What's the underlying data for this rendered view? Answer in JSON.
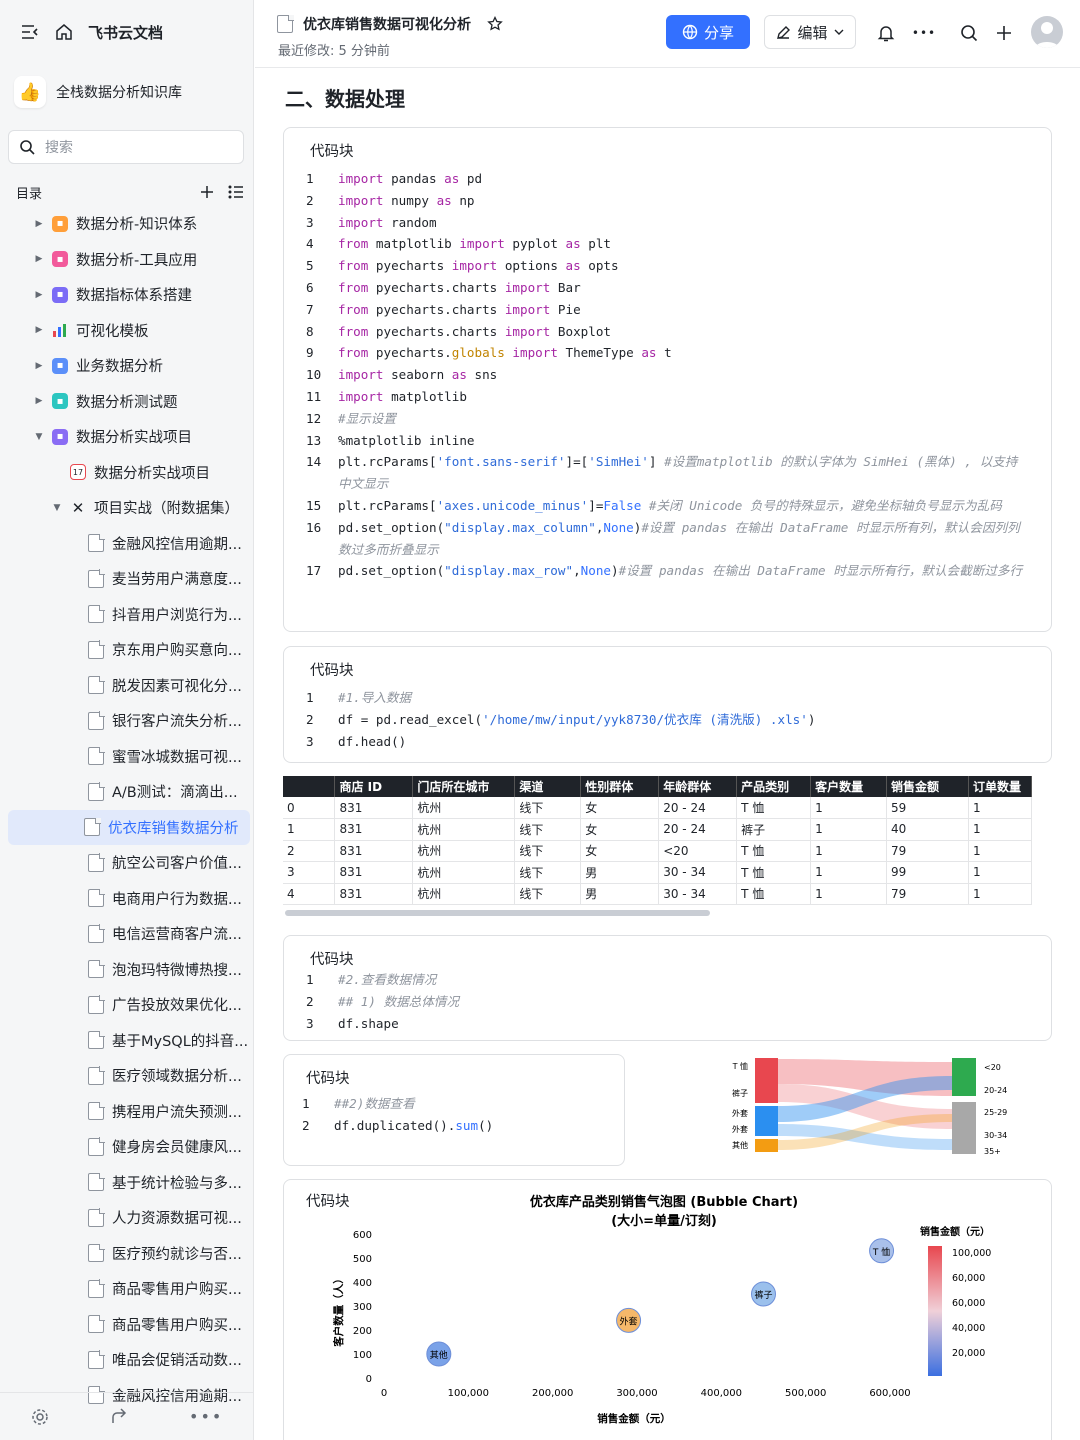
{
  "app": {
    "brand": "飞书云文档"
  },
  "kb": {
    "name": "全栈数据分析知识库"
  },
  "search": {
    "placeholder": "搜索"
  },
  "toc": {
    "label": "目录"
  },
  "tree": [
    {
      "label": "数据分析-知识体系",
      "level": 0,
      "icon": "orange",
      "arrow": "right"
    },
    {
      "label": "数据分析-工具应用",
      "level": 0,
      "icon": "pink",
      "arrow": "right"
    },
    {
      "label": "数据指标体系搭建",
      "level": 0,
      "icon": "purple",
      "arrow": "right"
    },
    {
      "label": "可视化模板",
      "level": 0,
      "icon": "bars",
      "arrow": "right"
    },
    {
      "label": "业务数据分析",
      "level": 0,
      "icon": "blue",
      "arrow": "right"
    },
    {
      "label": "数据分析测试题",
      "level": 0,
      "icon": "teal",
      "arrow": "right"
    },
    {
      "label": "数据分析实战项目",
      "level": 0,
      "icon": "violet",
      "arrow": "down"
    },
    {
      "label": "数据分析实战项目",
      "level": 1,
      "icon": "calendar",
      "arrow": ""
    },
    {
      "label": "项目实战（附数据集）",
      "level": 1,
      "icon": "cross",
      "arrow": "down"
    },
    {
      "label": "金融风控信用逾期...",
      "level": 2,
      "icon": "doc"
    },
    {
      "label": "麦当劳用户满意度...",
      "level": 2,
      "icon": "doc"
    },
    {
      "label": "抖音用户浏览行为...",
      "level": 2,
      "icon": "doc"
    },
    {
      "label": "京东用户购买意向...",
      "level": 2,
      "icon": "doc"
    },
    {
      "label": "脱发因素可视化分...",
      "level": 2,
      "icon": "doc"
    },
    {
      "label": "银行客户流失分析...",
      "level": 2,
      "icon": "doc"
    },
    {
      "label": "蜜雪冰城数据可视...",
      "level": 2,
      "icon": "doc"
    },
    {
      "label": "A/B测试：滴滴出...",
      "level": 2,
      "icon": "doc"
    },
    {
      "label": "优衣库销售数据分析",
      "level": 2,
      "icon": "doc",
      "active": true
    },
    {
      "label": "航空公司客户价值...",
      "level": 2,
      "icon": "doc"
    },
    {
      "label": "电商用户行为数据...",
      "level": 2,
      "icon": "doc"
    },
    {
      "label": "电信运营商客户流...",
      "level": 2,
      "icon": "doc"
    },
    {
      "label": "泡泡玛特微博热搜...",
      "level": 2,
      "icon": "doc"
    },
    {
      "label": "广告投放效果优化...",
      "level": 2,
      "icon": "doc"
    },
    {
      "label": "基于MySQL的抖音...",
      "level": 2,
      "icon": "doc"
    },
    {
      "label": "医疗领域数据分析...",
      "level": 2,
      "icon": "doc"
    },
    {
      "label": "携程用户流失预测...",
      "level": 2,
      "icon": "doc"
    },
    {
      "label": "健身房会员健康风...",
      "level": 2,
      "icon": "doc"
    },
    {
      "label": "基于统计检验与多...",
      "level": 2,
      "icon": "doc"
    },
    {
      "label": "人力资源数据可视...",
      "level": 2,
      "icon": "doc"
    },
    {
      "label": "医疗预约就诊与否...",
      "level": 2,
      "icon": "doc"
    },
    {
      "label": "商品零售用户购买...",
      "level": 2,
      "icon": "doc"
    },
    {
      "label": "商品零售用户购买...",
      "level": 2,
      "icon": "doc"
    },
    {
      "label": "唯品会促销活动数...",
      "level": 2,
      "icon": "doc"
    },
    {
      "label": "金融风控信用逾期...",
      "level": 2,
      "icon": "doc"
    }
  ],
  "doc": {
    "title": "优衣库销售数据可视化分析",
    "modified": "最近修改: 5 分钟前",
    "share": "分享",
    "edit": "编辑",
    "h2": "二、数据处理"
  },
  "code_label": "代码块",
  "code1": [
    [
      [
        "kw",
        "import"
      ],
      [
        "",
        "pandas "
      ],
      [
        "kw",
        "as"
      ],
      [
        "",
        "pd"
      ]
    ],
    [
      [
        "kw",
        "import"
      ],
      [
        "",
        "numpy "
      ],
      [
        "kw",
        "as"
      ],
      [
        "",
        "np"
      ]
    ],
    [
      [
        "kw",
        "import"
      ],
      [
        "",
        "random"
      ]
    ],
    [
      [
        "kw",
        "from"
      ],
      [
        "",
        "matplotlib "
      ],
      [
        "kw",
        "import"
      ],
      [
        "",
        "pyplot "
      ],
      [
        "kw",
        "as"
      ],
      [
        "",
        "plt"
      ]
    ],
    [
      [
        "kw",
        "from"
      ],
      [
        "",
        "pyecharts "
      ],
      [
        "kw",
        "import"
      ],
      [
        "",
        "options "
      ],
      [
        "kw",
        "as"
      ],
      [
        "",
        "opts"
      ]
    ],
    [
      [
        "kw",
        "from"
      ],
      [
        "",
        "pyecharts.charts "
      ],
      [
        "kw",
        "import"
      ],
      [
        "",
        "Bar"
      ]
    ],
    [
      [
        "kw",
        "from"
      ],
      [
        "",
        "pyecharts.charts "
      ],
      [
        "kw",
        "import"
      ],
      [
        "",
        "Pie"
      ]
    ],
    [
      [
        "kw",
        "from"
      ],
      [
        "",
        "pyecharts.charts "
      ],
      [
        "kw",
        "import"
      ],
      [
        "",
        "Boxplot"
      ]
    ],
    [
      [
        "kw",
        "from"
      ],
      [
        "",
        "pyecharts."
      ],
      [
        "nm",
        "globals"
      ],
      [
        "",
        ""
      ],
      [
        "kw",
        " import"
      ],
      [
        "",
        "ThemeType "
      ],
      [
        "kw",
        "as"
      ],
      [
        "",
        "t"
      ]
    ],
    [
      [
        "kw",
        "import"
      ],
      [
        "",
        "seaborn "
      ],
      [
        "kw",
        "as"
      ],
      [
        "",
        "sns"
      ]
    ],
    [
      [
        "kw",
        "import"
      ],
      [
        "",
        "matplotlib"
      ]
    ],
    [
      [
        "cm",
        "#显示设置"
      ]
    ],
    [
      [
        "",
        "%matplotlib inline"
      ]
    ],
    [
      [
        "",
        "plt.rcParams["
      ],
      [
        "st",
        "'font.sans-serif'"
      ],
      [
        "",
        "]=["
      ],
      [
        "st",
        "'SimHei'"
      ],
      [
        "",
        "] "
      ],
      [
        "cm",
        "#设置matplotlib 的默认字体为 SimHei (黑体) , 以支持中文显示"
      ]
    ],
    [
      [
        "",
        "plt.rcParams["
      ],
      [
        "st",
        "'axes.unicode_minus'"
      ],
      [
        "",
        "]="
      ],
      [
        "bl",
        "False"
      ],
      [
        "",
        ""
      ],
      [
        "cm",
        " #关闭 Unicode 负号的特殊显示，避免坐标轴负号显示为乱码"
      ]
    ],
    [
      [
        "",
        "pd.set_option("
      ],
      [
        "st",
        "\"display.max_column\""
      ],
      [
        "",
        ","
      ],
      [
        "bl",
        "None"
      ],
      [
        "",
        ")"
      ],
      [
        "cm",
        "#设置 pandas 在输出 DataFrame 时显示所有列，默认会因列列数过多而折叠显示"
      ]
    ],
    [
      [
        "",
        "pd.set_option("
      ],
      [
        "st",
        "\"display.max_row\""
      ],
      [
        "",
        ","
      ],
      [
        "bl",
        "None"
      ],
      [
        "",
        ")"
      ],
      [
        "cm",
        "#设置 pandas 在输出 DataFrame 时显示所有行，默认会截断过多行"
      ]
    ]
  ],
  "code2": [
    [
      [
        "cm",
        "#1.导入数据"
      ]
    ],
    [
      [
        "",
        "df = pd.read_excel("
      ],
      [
        "st",
        "'/home/mw/input/yyk8730/优衣库 (清洗版) .xls'"
      ],
      [
        "",
        ")"
      ]
    ],
    [
      [
        "",
        "df.head()"
      ]
    ]
  ],
  "code3": [
    [
      [
        "cm",
        "#2.查看数据情况"
      ]
    ],
    [
      [
        "cm",
        "## 1) 数据总体情况"
      ]
    ],
    [
      [
        "",
        "df.shape"
      ]
    ]
  ],
  "code4": [
    [
      [
        "cm",
        "##2)数据查看"
      ]
    ],
    [
      [
        "",
        "df.duplicated()."
      ],
      [
        "bl",
        "sum"
      ],
      [
        "",
        "()"
      ]
    ]
  ],
  "table": {
    "headers": [
      "",
      "商店 ID",
      "门店所在城市",
      "渠道",
      "性别群体",
      "年龄群体",
      "产品类别",
      "客户数量",
      "销售金额",
      "订单数量"
    ],
    "rows": [
      [
        "0",
        "831",
        "杭州",
        "线下",
        "女",
        "20 - 24",
        "T 恤",
        "1",
        "59",
        "1"
      ],
      [
        "1",
        "831",
        "杭州",
        "线下",
        "女",
        "20 - 24",
        "裤子",
        "1",
        "40",
        "1"
      ],
      [
        "2",
        "831",
        "杭州",
        "线下",
        "女",
        "<20",
        "T 恤",
        "1",
        "79",
        "1"
      ],
      [
        "3",
        "831",
        "杭州",
        "线下",
        "男",
        "30 - 34",
        "T 恤",
        "1",
        "99",
        "1"
      ],
      [
        "4",
        "831",
        "杭州",
        "线下",
        "男",
        "30 - 34",
        "T 恤",
        "1",
        "79",
        "1"
      ]
    ]
  },
  "sankey": {
    "left": [
      "T 恤",
      "裤子",
      "外套",
      "外套",
      "其他"
    ],
    "right": [
      "<20",
      "20-24",
      "25-29",
      "30-34",
      "35+"
    ],
    "colors": {
      "tshirt": "#e8474f",
      "coat": "#2b8ff0",
      "other": "#f39c12",
      "age1": "#2eaa4f",
      "age2": "#a8a8a8"
    }
  },
  "chart_data": {
    "type": "scatter",
    "title": "优衣库产品类别销售气泡图 (Bubble Chart)",
    "subtitle": "(大小=单量/订刻)",
    "xlabel": "销售金额（元）",
    "ylabel": "客户数量（人）",
    "xlim": [
      0,
      600000
    ],
    "ylim": [
      0,
      600
    ],
    "xticks": [
      "0",
      "100,000",
      "200,000",
      "300,000",
      "400,000",
      "500,000",
      "600,000"
    ],
    "yticks": [
      "0",
      "100",
      "200",
      "300",
      "400",
      "500",
      "600"
    ],
    "colorbar_label": "销售金额（元）",
    "colorbar_ticks": [
      "100,000",
      "60,000",
      "60,000",
      "40,000",
      "20,000"
    ],
    "points": [
      {
        "label": "其他",
        "x": 65000,
        "y": 100,
        "color": "#7aa2e8"
      },
      {
        "label": "外套",
        "x": 290000,
        "y": 240,
        "color": "#f5b86a"
      },
      {
        "label": "裤子",
        "x": 450000,
        "y": 350,
        "color": "#9bc0ec"
      },
      {
        "label": "T 恤",
        "x": 590000,
        "y": 530,
        "color": "#a9c0ea"
      }
    ]
  }
}
